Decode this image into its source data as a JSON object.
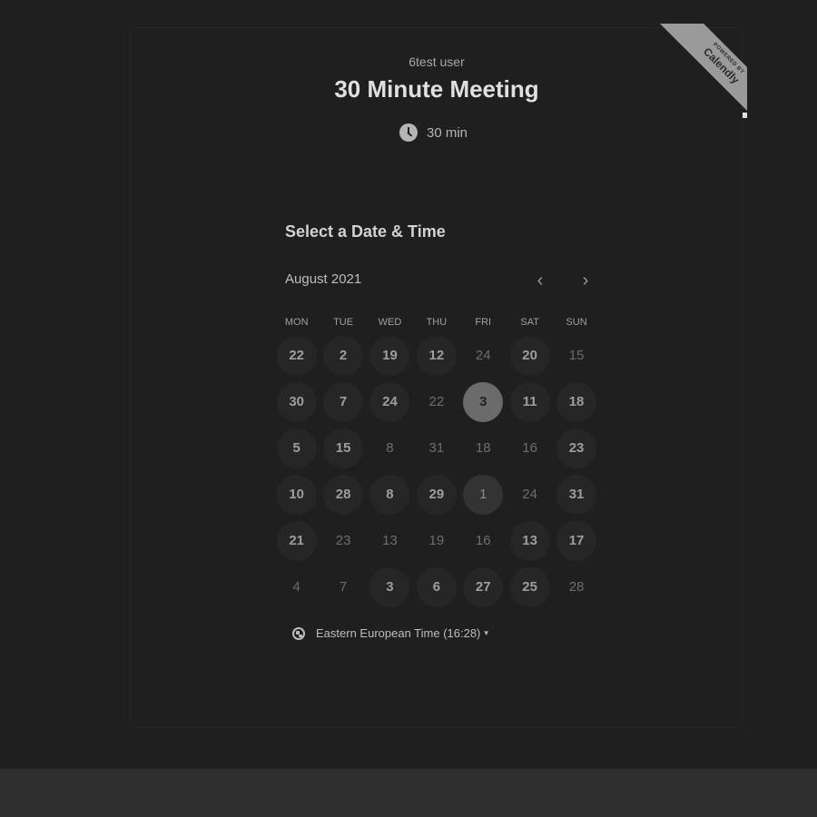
{
  "host": {
    "name": "6test user"
  },
  "event": {
    "title": "30 Minute Meeting",
    "duration": "30 min"
  },
  "badge": {
    "powered": "POWERED BY",
    "brand": "Calendly"
  },
  "calendar": {
    "heading": "Select a Date & Time",
    "month": "August 2021",
    "prev_icon": "‹",
    "next_icon": "›",
    "weekdays": [
      "MON",
      "TUE",
      "WED",
      "THU",
      "FRI",
      "SAT",
      "SUN"
    ],
    "days": [
      {
        "label": "22",
        "state": "avail"
      },
      {
        "label": "2",
        "state": "avail"
      },
      {
        "label": "19",
        "state": "avail"
      },
      {
        "label": "12",
        "state": "avail"
      },
      {
        "label": "24",
        "state": "off"
      },
      {
        "label": "20",
        "state": "avail"
      },
      {
        "label": "15",
        "state": "off"
      },
      {
        "label": "30",
        "state": "avail"
      },
      {
        "label": "7",
        "state": "avail"
      },
      {
        "label": "24",
        "state": "avail"
      },
      {
        "label": "22",
        "state": "off"
      },
      {
        "label": "3",
        "state": "selected"
      },
      {
        "label": "11",
        "state": "avail"
      },
      {
        "label": "18",
        "state": "avail"
      },
      {
        "label": "5",
        "state": "avail"
      },
      {
        "label": "15",
        "state": "avail"
      },
      {
        "label": "8",
        "state": "off"
      },
      {
        "label": "31",
        "state": "off"
      },
      {
        "label": "18",
        "state": "off"
      },
      {
        "label": "16",
        "state": "off"
      },
      {
        "label": "23",
        "state": "avail"
      },
      {
        "label": "10",
        "state": "avail"
      },
      {
        "label": "28",
        "state": "avail"
      },
      {
        "label": "8",
        "state": "avail"
      },
      {
        "label": "29",
        "state": "avail"
      },
      {
        "label": "1",
        "state": "hover"
      },
      {
        "label": "24",
        "state": "off"
      },
      {
        "label": "31",
        "state": "avail"
      },
      {
        "label": "21",
        "state": "avail"
      },
      {
        "label": "23",
        "state": "off"
      },
      {
        "label": "13",
        "state": "off"
      },
      {
        "label": "19",
        "state": "off"
      },
      {
        "label": "16",
        "state": "off"
      },
      {
        "label": "13",
        "state": "avail"
      },
      {
        "label": "17",
        "state": "avail"
      },
      {
        "label": "4",
        "state": "off"
      },
      {
        "label": "7",
        "state": "off"
      },
      {
        "label": "3",
        "state": "avail"
      },
      {
        "label": "6",
        "state": "avail"
      },
      {
        "label": "27",
        "state": "avail"
      },
      {
        "label": "25",
        "state": "avail"
      },
      {
        "label": "28",
        "state": "off"
      }
    ]
  },
  "timezone": {
    "label": "Eastern European Time (16:28)",
    "caret": "▾"
  },
  "colors": {
    "background": "#1f1f1f",
    "selected": "#6b6b6b",
    "available": "#262626"
  }
}
